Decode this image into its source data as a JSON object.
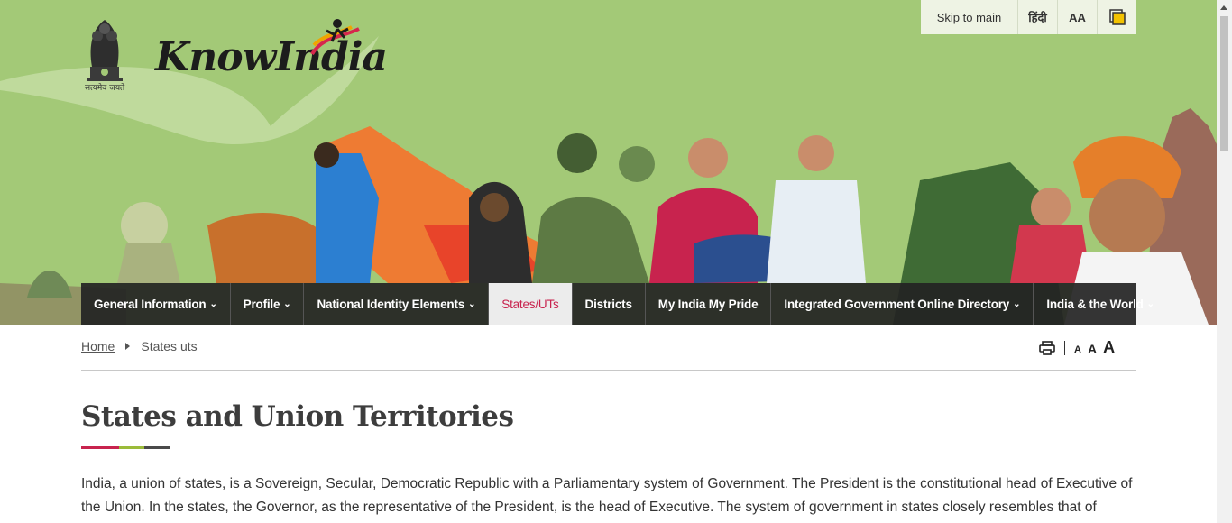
{
  "branding": {
    "emblem_caption": "सत्यमेव जयते",
    "logo_text": "KnowIndia"
  },
  "utility_bar": {
    "skip_label": "Skip to main",
    "hindi_label": "हिंदी",
    "font_label": "AA",
    "contrast_icon": "contrast-icon"
  },
  "nav": {
    "items": [
      {
        "label": "General Information",
        "has_dropdown": true
      },
      {
        "label": "Profile",
        "has_dropdown": true
      },
      {
        "label": "National Identity Elements",
        "has_dropdown": true
      },
      {
        "label": "States/UTs",
        "has_dropdown": false,
        "active": true
      },
      {
        "label": "Districts",
        "has_dropdown": false
      },
      {
        "label": "My India My Pride",
        "has_dropdown": false
      },
      {
        "label": "Integrated Government Online Directory",
        "has_dropdown": true
      },
      {
        "label": "India & the World",
        "has_dropdown": true
      }
    ]
  },
  "breadcrumb": {
    "home": "Home",
    "current": "States uts"
  },
  "tools": {
    "print_icon": "print-icon",
    "font_small": "A",
    "font_medium": "A",
    "font_large": "A"
  },
  "page": {
    "title": "States and Union Territories",
    "intro": "India, a union of states, is a Sovereign, Secular, Democratic Republic with a Parliamentary system of Government. The President is the constitutional head of Executive of the Union. In the states, the Governor, as the representative of the President, is the head of Executive. The system of government in states closely resembles that of"
  },
  "colors": {
    "banner_green": "#a3c977",
    "nav_dark": "#232323",
    "active_tab_text": "#c8234e",
    "underline": [
      "#c8234e",
      "#9bbb3a",
      "#4a4a4a"
    ]
  }
}
